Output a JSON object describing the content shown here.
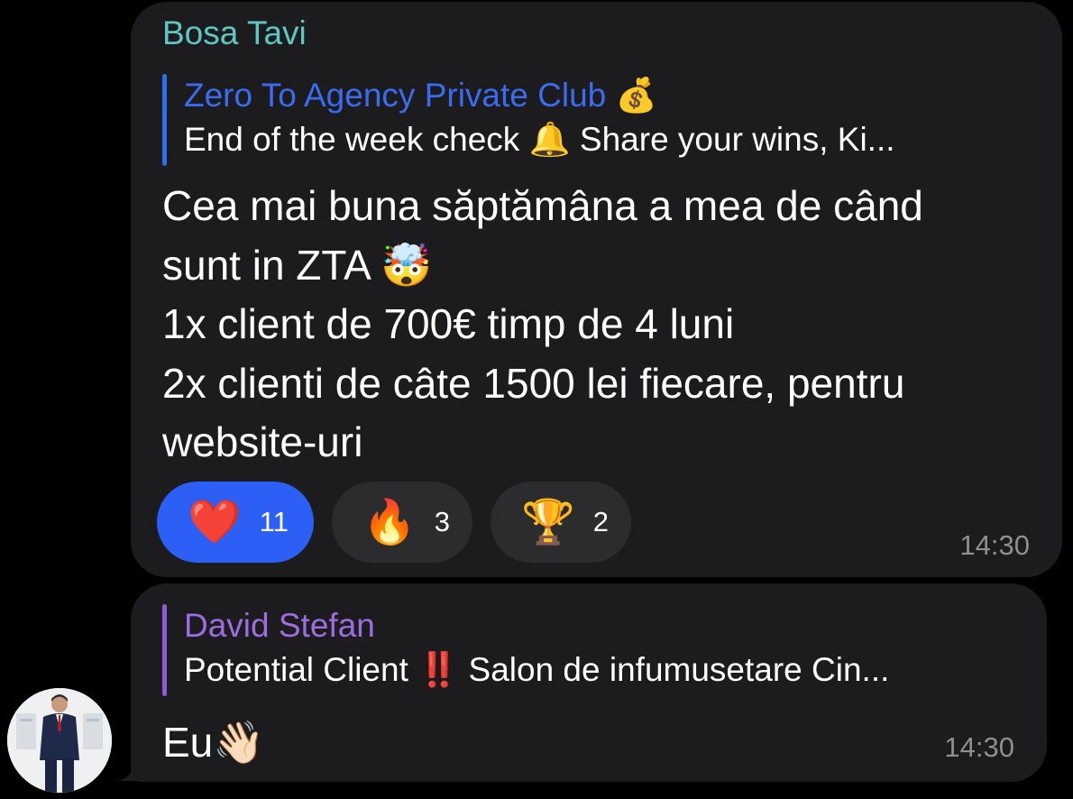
{
  "colors": {
    "background": "#000000",
    "bubble": "#1c1c1e",
    "sender_name": "#5fc7c2",
    "reply_1_accent": "#2f6cf0",
    "reply_2_accent": "#8f5ad6",
    "active_reaction": "#2b5ff5",
    "reaction": "#2c2c2e",
    "timestamp": "#8e8e93"
  },
  "message_1": {
    "sender": "Bosa Tavi",
    "reply": {
      "title": "Zero To Agency Private Club",
      "title_emoji": "💰",
      "text_before": "End of the week check ",
      "text_emoji": "🔔",
      "text_after": "  Share your wins, Ki..."
    },
    "lines": [
      "Cea mai buna săptămâna a mea de când",
      "sunt in ZTA",
      "1x client de 700€ timp de 4 luni",
      "2x clienti de câte 1500 lei fiecare, pentru",
      "website-uri"
    ],
    "line_2_emoji": "🤯",
    "reactions": [
      {
        "emoji": "❤️",
        "icon": "heart-icon",
        "count": "11",
        "active": true
      },
      {
        "emoji": "🔥",
        "icon": "fire-icon",
        "count": "3",
        "active": false
      },
      {
        "emoji": "🏆",
        "icon": "trophy-icon",
        "count": "2",
        "active": false
      }
    ],
    "time": "14:30"
  },
  "message_2": {
    "reply": {
      "title": "David Stefan",
      "text_before": "Potential Client ",
      "text_emoji": "‼️",
      "text_after": " Salon de infumusetare Cin..."
    },
    "text": "Eu",
    "text_emoji": "👋🏻",
    "time": "14:30",
    "avatar_icon": "person-avatar"
  }
}
